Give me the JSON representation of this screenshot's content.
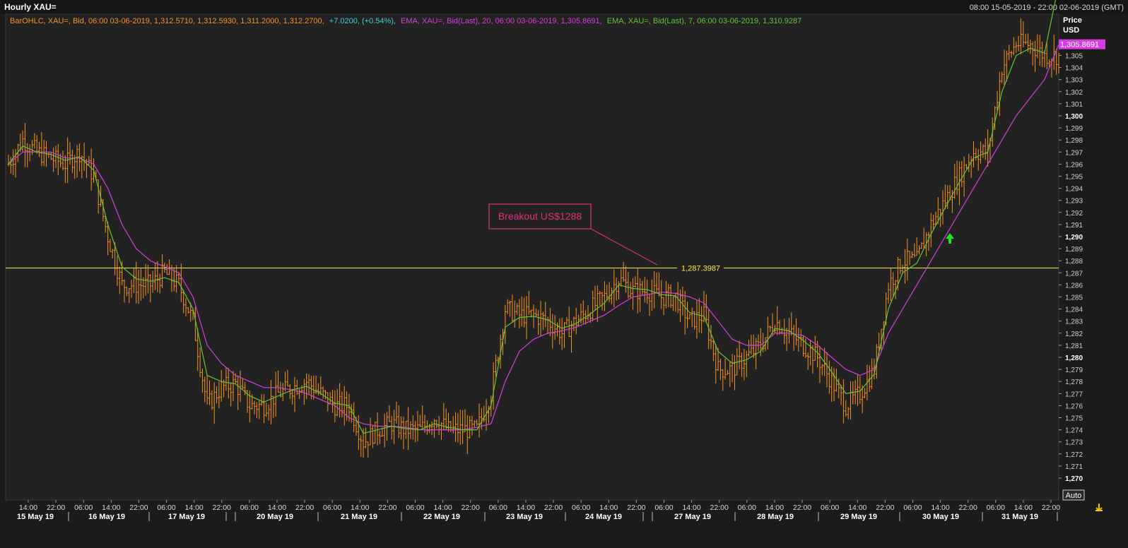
{
  "window": {
    "title": "Hourly XAU=",
    "date_range": "08:00 15-05-2019 - 22:00 02-06-2019 (GMT)"
  },
  "legend": {
    "ohlc_text": "BarOHLC, XAU=, Bid, 06:00 03-06-2019, 1,312.5710, 1,312.5930, 1,311.2000, 1,312.2700,",
    "change_text": "+7.0200, (+0.54%),",
    "ema20_text": "EMA, XAU=, Bid(Last), 20, 06:00 03-06-2019, 1,305.8691,",
    "ema7_text": "EMA, XAU=, Bid(Last), 7, 06:00 03-06-2019, 1,310.9287"
  },
  "price_axis": {
    "title_line1": "Price",
    "title_line2": "USD",
    "current_value_tag": "1,305.8691"
  },
  "auto_button": {
    "label": "Auto"
  },
  "annotation": {
    "callout_text": "Breakout US$1288",
    "level_label": "1,287.3987"
  },
  "colors": {
    "background": "#222222",
    "bars": "#f7931e",
    "ema20": "#d63de0",
    "ema7": "#62c62f",
    "level_line": "#f1e94b",
    "callout": "#e0307a",
    "arrow": "#1ee51e",
    "change": "#35d1e0"
  },
  "chart_data": {
    "type": "line",
    "title": "Hourly XAU=",
    "ylabel": "Price USD",
    "ylim": [
      1269,
      1308
    ],
    "y_ticks": [
      "1,270",
      "1,271",
      "1,272",
      "1,273",
      "1,274",
      "1,275",
      "1,276",
      "1,277",
      "1,278",
      "1,279",
      "1,280",
      "1,281",
      "1,282",
      "1,283",
      "1,284",
      "1,285",
      "1,286",
      "1,287",
      "1,288",
      "1,289",
      "1,290",
      "1,291",
      "1,292",
      "1,293",
      "1,294",
      "1,295",
      "1,296",
      "1,297",
      "1,298",
      "1,299",
      "1,300",
      "1,301",
      "1,302",
      "1,303",
      "1,304",
      "1,305"
    ],
    "y_ticks_bold": [
      "1,270",
      "1,280",
      "1,290",
      "1,300"
    ],
    "x_time_ticks": [
      "14:00",
      "22:00",
      "06:00",
      "14:00",
      "22:00",
      "06:00",
      "14:00",
      "22:00",
      "06:00",
      "14:00",
      "22:00",
      "06:00",
      "14:00",
      "22:00",
      "06:00",
      "14:00",
      "22:00",
      "06:00",
      "14:00",
      "22:00",
      "06:00",
      "14:00",
      "22:00",
      "06:00",
      "14:00",
      "22:00",
      "06:00",
      "14:00",
      "22:00",
      "06:00",
      "14:00",
      "22:00",
      "06:00",
      "14:00",
      "22:00",
      "06:00",
      "14:00",
      "22:00"
    ],
    "x_day_labels": [
      "15 May 19",
      "16 May 19",
      "17 May 19",
      "20 May 19",
      "21 May 19",
      "22 May 19",
      "23 May 19",
      "24 May 19",
      "27 May 19",
      "28 May 19",
      "29 May 19",
      "30 May 19",
      "31 May 19"
    ],
    "horizontal_level": 1287.3987,
    "series": [
      {
        "name": "BarOHLC, XAU=, Bid",
        "kind": "ohlc-close",
        "x": [
          0,
          6,
          12,
          18,
          24,
          30,
          36,
          42,
          48,
          54,
          60,
          66,
          72,
          78,
          84,
          90,
          96,
          102,
          108,
          114,
          120,
          126,
          132,
          138,
          144,
          150,
          156,
          162,
          168,
          174,
          180,
          186,
          192,
          198,
          204,
          210,
          216,
          222,
          228,
          234,
          240,
          246,
          252,
          258,
          264,
          270,
          276,
          282,
          288,
          294,
          300,
          306,
          312,
          318,
          324,
          330,
          336,
          342,
          348,
          354,
          360,
          366,
          372,
          378,
          384,
          390,
          396,
          402,
          408,
          414,
          420,
          426,
          432,
          438,
          444
        ],
        "values": [
          1296,
          1298,
          1297,
          1296.5,
          1296,
          1297,
          1295,
          1290,
          1286,
          1286,
          1286,
          1287,
          1286,
          1283,
          1276,
          1277.5,
          1277.8,
          1276,
          1276,
          1277,
          1277.5,
          1278,
          1277,
          1276,
          1276,
          1273,
          1274,
          1274.5,
          1274,
          1274,
          1275,
          1274,
          1274,
          1274,
          1277,
          1284,
          1283.5,
          1283.5,
          1283,
          1282,
          1283,
          1284,
          1285,
          1286.5,
          1285.5,
          1285.5,
          1285,
          1285,
          1283,
          1283.5,
          1279,
          1279,
          1280,
          1281,
          1283,
          1282,
          1281,
          1280,
          1278,
          1276,
          1277,
          1279,
          1286,
          1288,
          1288,
          1291,
          1293,
          1295,
          1297,
          1297,
          1304,
          1306,
          1305.9,
          1305,
          1305
        ]
      },
      {
        "name": "EMA, XAU=, Bid(Last), 20",
        "kind": "ema20",
        "x": [
          0,
          6,
          12,
          18,
          24,
          30,
          36,
          42,
          48,
          54,
          60,
          66,
          72,
          78,
          84,
          90,
          96,
          102,
          108,
          114,
          120,
          126,
          132,
          138,
          144,
          150,
          156,
          162,
          168,
          174,
          180,
          186,
          192,
          198,
          204,
          210,
          216,
          222,
          228,
          234,
          240,
          246,
          252,
          258,
          264,
          270,
          276,
          282,
          288,
          294,
          300,
          306,
          312,
          318,
          324,
          330,
          336,
          342,
          348,
          354,
          360,
          366,
          372,
          378,
          384,
          390,
          396,
          402,
          408,
          414,
          420,
          426,
          432,
          438,
          444
        ],
        "values": [
          1296,
          1297,
          1297,
          1297,
          1296.5,
          1296.5,
          1296,
          1294,
          1291,
          1289,
          1288,
          1287.5,
          1287,
          1285,
          1281,
          1279.5,
          1278.5,
          1278,
          1277.5,
          1277.5,
          1277.3,
          1277,
          1276.5,
          1276,
          1275,
          1274.5,
          1274.3,
          1274.3,
          1274.2,
          1274,
          1274,
          1274,
          1274,
          1274.2,
          1274.5,
          1278,
          1280.5,
          1281.5,
          1282,
          1282.2,
          1282.5,
          1283,
          1283.5,
          1284.3,
          1285,
          1285.2,
          1285.4,
          1285.3,
          1285,
          1284.5,
          1283,
          1281.5,
          1281,
          1281,
          1282,
          1282,
          1281.8,
          1281,
          1280,
          1279,
          1278.5,
          1279,
          1282,
          1284,
          1286,
          1288,
          1290,
          1292,
          1294,
          1296,
          1298,
          1300,
          1301.5,
          1303,
          1305.9
        ]
      },
      {
        "name": "EMA, XAU=, Bid(Last), 7",
        "kind": "ema7",
        "x": [
          0,
          6,
          12,
          18,
          24,
          30,
          36,
          42,
          48,
          54,
          60,
          66,
          72,
          78,
          84,
          90,
          96,
          102,
          108,
          114,
          120,
          126,
          132,
          138,
          144,
          150,
          156,
          162,
          168,
          174,
          180,
          186,
          192,
          198,
          204,
          210,
          216,
          222,
          228,
          234,
          240,
          246,
          252,
          258,
          264,
          270,
          276,
          282,
          288,
          294,
          300,
          306,
          312,
          318,
          324,
          330,
          336,
          342,
          348,
          354,
          360,
          366,
          372,
          378,
          384,
          390,
          396,
          402,
          408,
          414,
          420,
          426,
          432,
          438,
          444
        ],
        "values": [
          1296,
          1297.5,
          1297,
          1296.8,
          1296.3,
          1296.6,
          1295.5,
          1291,
          1287.5,
          1286.5,
          1286.3,
          1286.6,
          1286.2,
          1284,
          1278.5,
          1278,
          1277.8,
          1276.8,
          1276.3,
          1276.8,
          1277.3,
          1277.6,
          1277,
          1276.2,
          1276,
          1273.7,
          1274,
          1274.3,
          1274.1,
          1274,
          1274.5,
          1274.2,
          1274,
          1274,
          1276,
          1282.5,
          1283.3,
          1283.4,
          1283.1,
          1282.4,
          1282.8,
          1283.6,
          1284.5,
          1286,
          1285.7,
          1285.6,
          1285.2,
          1285.1,
          1283.7,
          1283.4,
          1280.5,
          1279.5,
          1279.8,
          1280.5,
          1282.4,
          1282.2,
          1281.4,
          1280.4,
          1278.8,
          1277,
          1277.2,
          1278.6,
          1284,
          1287,
          1287.8,
          1290.2,
          1292.4,
          1294.5,
          1296.5,
          1297,
          1302,
          1305,
          1305.6,
          1305.2,
          1310.9
        ]
      }
    ]
  }
}
